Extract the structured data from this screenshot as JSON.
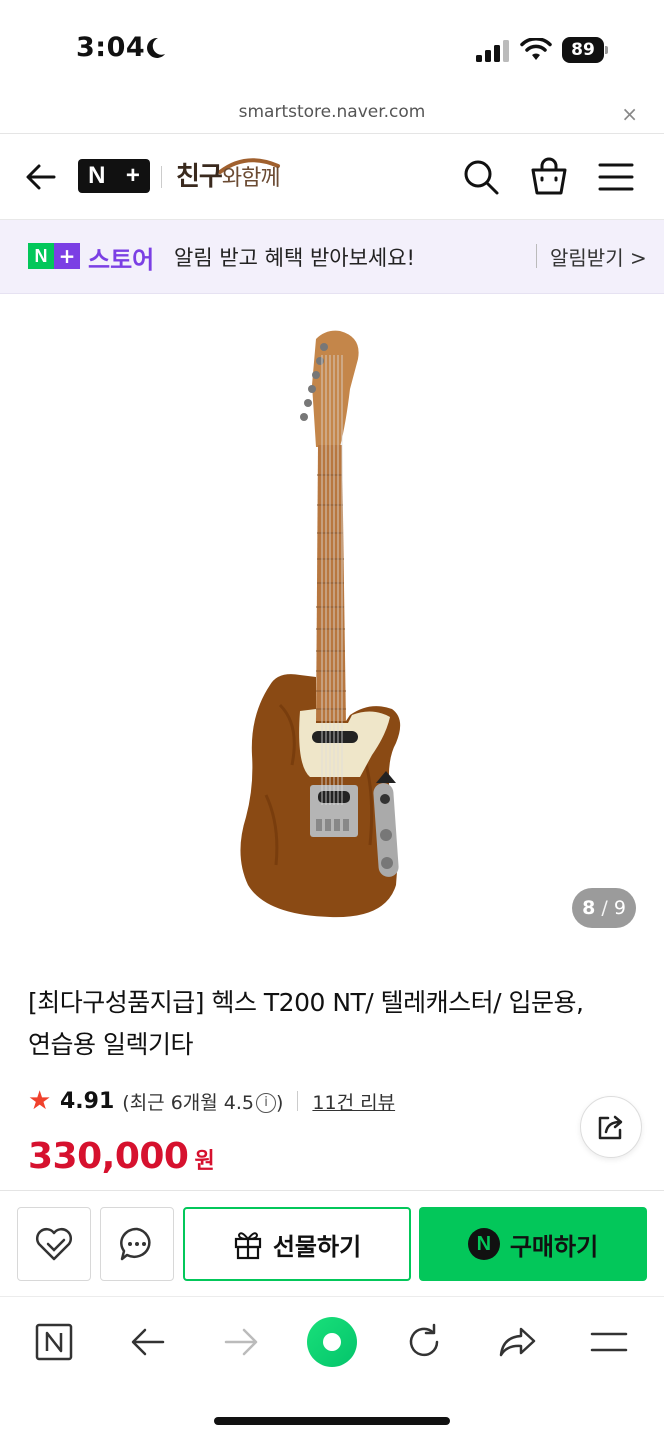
{
  "status_bar": {
    "time": "3:04",
    "battery": "89"
  },
  "url_bar": {
    "domain": "smartstore.naver.com",
    "close_label": "×"
  },
  "header": {
    "logo_n": "N",
    "logo_plus": "+",
    "store_name_main": "친구",
    "store_name_sub": "와함께"
  },
  "banner": {
    "badge_n": "N",
    "badge_plus": "+",
    "store_word": "스토어",
    "message": "알림 받고 혜택 받아보세요!",
    "action": "알림받기 >"
  },
  "gallery": {
    "current": "8",
    "separator": "/",
    "total": "9"
  },
  "product": {
    "title_line1": "[최다구성품지급] 헥스 T200 NT/ 텔레캐스터/ 입문용,",
    "title_line2": "연습용 일렉기타",
    "rating": "4.91",
    "recent_rating_prefix": "(최근 6개월 4.5",
    "recent_rating_suffix": ")",
    "review_count": "11건 리뷰",
    "price": "330,000",
    "price_unit": "원"
  },
  "actions": {
    "gift": "선물하기",
    "buy": "구매하기",
    "npay_letter": "N"
  },
  "colors": {
    "naver_green": "#03c75a",
    "price_red": "#d6112e",
    "store_purple": "#7b3fe4"
  }
}
